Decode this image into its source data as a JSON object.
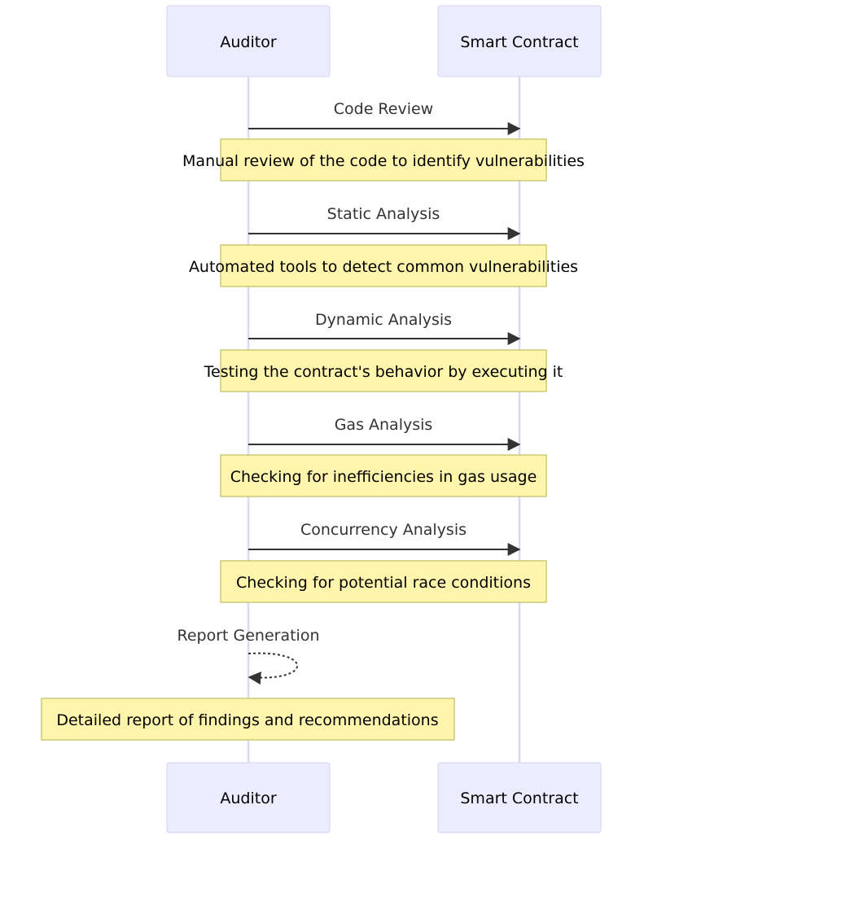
{
  "diagram": {
    "type": "sequence",
    "colors": {
      "actor_fill": "#ECECFF",
      "actor_border": "#D6D3F4",
      "lifeline": "#DCD8F2",
      "message_line": "#333333",
      "note_fill": "#FFF5AD",
      "note_border": "#BFBF5E"
    },
    "actors": [
      {
        "id": "auditor",
        "label": "Auditor"
      },
      {
        "id": "contract",
        "label": "Smart Contract"
      }
    ],
    "messages": [
      {
        "from": "auditor",
        "to": "contract",
        "label": "Code Review",
        "style": "solid",
        "note": "Manual review of the code to identify vulnerabilities"
      },
      {
        "from": "auditor",
        "to": "contract",
        "label": "Static Analysis",
        "style": "solid",
        "note": "Automated tools to detect common vulnerabilities"
      },
      {
        "from": "auditor",
        "to": "contract",
        "label": "Dynamic Analysis",
        "style": "solid",
        "note": "Testing the contract's behavior by executing it"
      },
      {
        "from": "auditor",
        "to": "contract",
        "label": "Gas Analysis",
        "style": "solid",
        "note": "Checking for inefficiencies in gas usage"
      },
      {
        "from": "auditor",
        "to": "contract",
        "label": "Concurrency Analysis",
        "style": "solid",
        "note": "Checking for potential race conditions"
      },
      {
        "from": "auditor",
        "to": "auditor",
        "label": "Report Generation",
        "style": "dotted",
        "note": "Detailed report of findings and recommendations"
      }
    ]
  }
}
